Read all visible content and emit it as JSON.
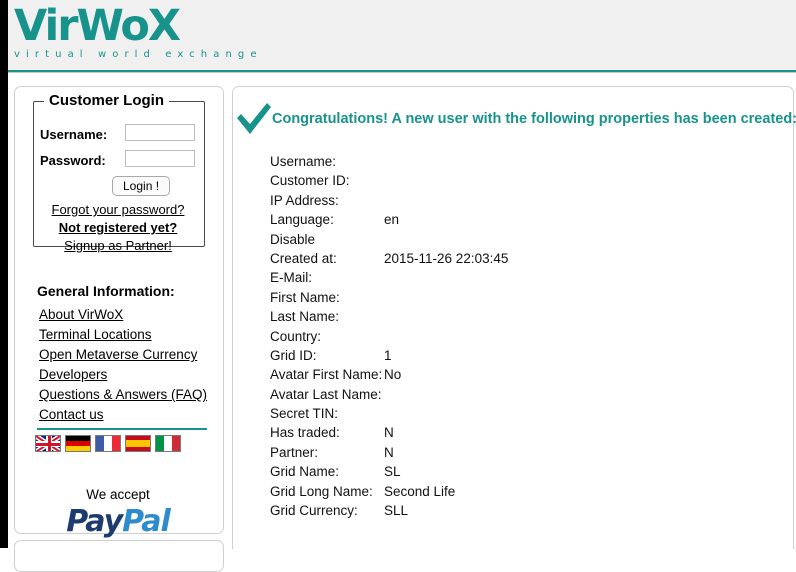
{
  "brand": {
    "logo_text": "VirWoX",
    "tagline": "virtual world exchange",
    "accent_color": "#17938c"
  },
  "sidebar": {
    "login": {
      "legend": "Customer Login",
      "username_label": "Username:",
      "username_value": "",
      "username_placeholder": "",
      "password_label": "Password:",
      "password_value": "",
      "password_placeholder": "",
      "submit_label": "Login !",
      "links": [
        "Forgot your password?",
        "Not registered yet?",
        "Signup as Partner!"
      ]
    },
    "general_information": {
      "title": "General Information:",
      "links": [
        "About VirWoX",
        "Terminal Locations",
        "Open Metaverse Currency",
        "Developers",
        "Questions & Answers (FAQ)",
        "Contact us"
      ]
    },
    "languages": [
      {
        "name": "flag-uk-icon",
        "title": "English"
      },
      {
        "name": "flag-germany-icon",
        "title": "Deutsch"
      },
      {
        "name": "flag-france-icon",
        "title": "Français"
      },
      {
        "name": "flag-spain-icon",
        "title": "Español"
      },
      {
        "name": "flag-italy-icon",
        "title": "Italiano"
      }
    ],
    "payment": {
      "we_accept": "We accept",
      "paypal_part1": "Pay",
      "paypal_part2": "Pal"
    }
  },
  "main": {
    "status_icon": "checkmark-icon",
    "heading": "Congratulations! A new user with the following properties has been created:",
    "properties": [
      {
        "label": "Username:",
        "value": ""
      },
      {
        "label": "Customer ID:",
        "value": ""
      },
      {
        "label": "IP Address:",
        "value": ""
      },
      {
        "label": "Language:",
        "value": "en"
      },
      {
        "label": "Disable",
        "value": ""
      },
      {
        "label": "Created at:",
        "value": "2015-11-26 22:03:45"
      },
      {
        "label": "E-Mail:",
        "value": ""
      },
      {
        "label": "First Name:",
        "value": ""
      },
      {
        "label": "Last Name:",
        "value": ""
      },
      {
        "label": "Country:",
        "value": ""
      },
      {
        "label": "Grid ID:",
        "value": "1"
      },
      {
        "label": "Avatar First Name:",
        "value": "No"
      },
      {
        "label": "Avatar Last Name:",
        "value": ""
      },
      {
        "label": "Secret TIN:",
        "value": ""
      },
      {
        "label": "Has traded:",
        "value": "N"
      },
      {
        "label": "Partner:",
        "value": "N"
      },
      {
        "label": "Grid Name:",
        "value": "SL"
      },
      {
        "label": "Grid Long Name:",
        "value": "Second Life"
      },
      {
        "label": "Grid Currency:",
        "value": "SLL"
      }
    ]
  }
}
